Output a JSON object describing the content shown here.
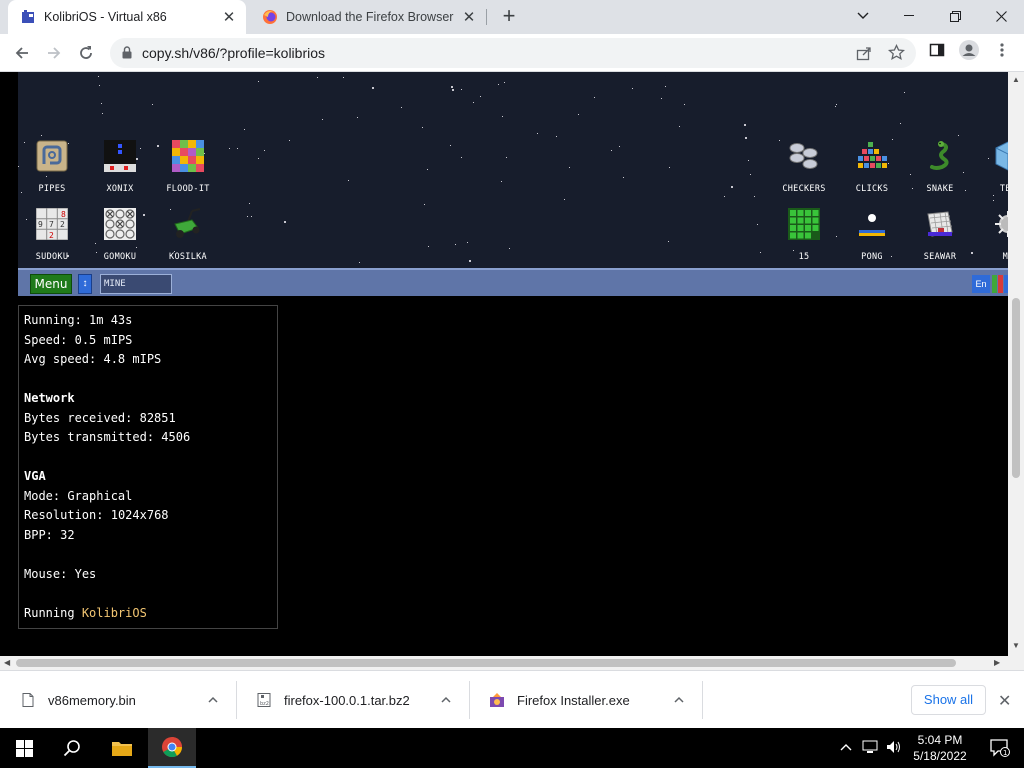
{
  "browser": {
    "tabs": [
      {
        "title": "KolibriOS - Virtual x86",
        "active": true
      },
      {
        "title": "Download the Firefox Browser in English (US) and more",
        "active": false
      }
    ],
    "url": "copy.sh/v86/?profile=kolibrios"
  },
  "emulator": {
    "desktop_icons": [
      {
        "label": "PIPES",
        "icon": "pipes-icon"
      },
      {
        "label": "XONIX",
        "icon": "xonix-icon"
      },
      {
        "label": "FLOOD-IT",
        "icon": "flood-it-icon"
      },
      {
        "label": "CHECKERS",
        "icon": "checkers-icon"
      },
      {
        "label": "CLICKS",
        "icon": "clicks-icon"
      },
      {
        "label": "SNAKE",
        "icon": "snake-icon"
      },
      {
        "label": "TET",
        "icon": "tetris-icon"
      },
      {
        "label": "SUDOKU",
        "icon": "sudoku-icon"
      },
      {
        "label": "GOMOKU",
        "icon": "gomoku-icon"
      },
      {
        "label": "KOSILKA",
        "icon": "kosilka-icon"
      },
      {
        "label": "15",
        "icon": "fifteen-icon"
      },
      {
        "label": "PONG",
        "icon": "pong-icon"
      },
      {
        "label": "SEAWAR",
        "icon": "seawar-icon"
      },
      {
        "label": "MI",
        "icon": "mine-icon"
      }
    ],
    "taskbar": {
      "menu_label": "Menu",
      "task_label": "MINE",
      "lang_label": "En"
    }
  },
  "stats": {
    "running_label": "Running:",
    "running_value": "1m 43s",
    "speed_label": "Speed:",
    "speed_value": "0.5 mIPS",
    "avg_label": "Avg speed:",
    "avg_value": "4.8 mIPS",
    "network_header": "Network",
    "rx_label": "Bytes received:",
    "rx_value": "82851",
    "tx_label": "Bytes transmitted:",
    "tx_value": "4506",
    "vga_header": "VGA",
    "mode_label": "Mode:",
    "mode_value": "Graphical",
    "res_label": "Resolution:",
    "res_value": "1024x768",
    "bpp_label": "BPP:",
    "bpp_value": "32",
    "mouse_label": "Mouse:",
    "mouse_value": "Yes",
    "os_label": "Running",
    "os_value": "KolibriOS"
  },
  "downloads": {
    "items": [
      {
        "name": "v86memory.bin"
      },
      {
        "name": "firefox-100.0.1.tar.bz2"
      },
      {
        "name": "Firefox Installer.exe"
      }
    ],
    "show_all": "Show all"
  },
  "windows": {
    "time": "5:04 PM",
    "date": "5/18/2022",
    "notification_count": "1"
  },
  "colors": {
    "desktop_bg": "#171d2c",
    "kolibri_taskbar": "#5f75a8",
    "menu_green": "#1f7a1a",
    "highlight": "#f2c572",
    "link_blue": "#1a73e8"
  }
}
